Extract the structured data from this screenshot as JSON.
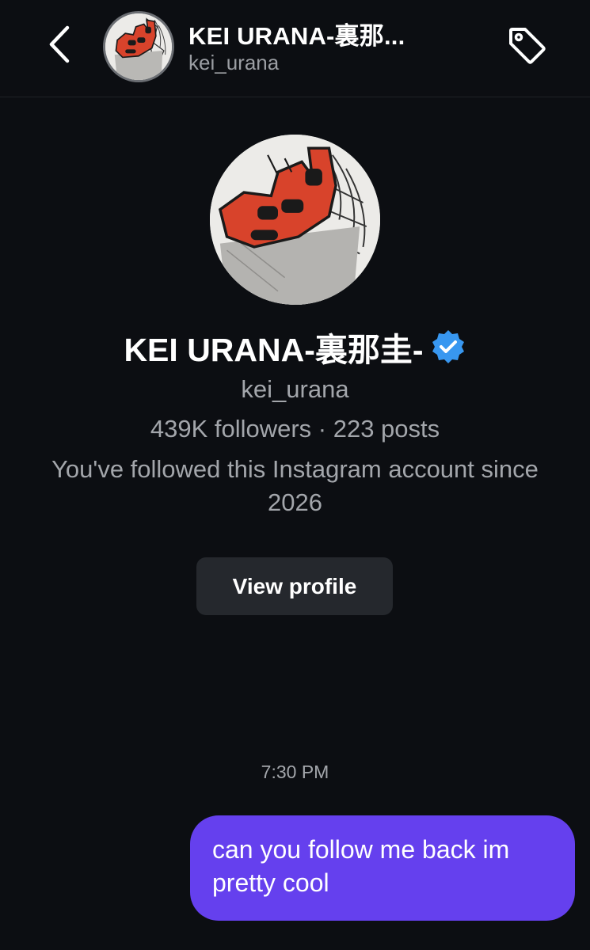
{
  "header": {
    "title": "KEI URANA-裏那...",
    "subtitle": "kei_urana"
  },
  "profile": {
    "name": "KEI URANA-裏那圭-",
    "username": "kei_urana",
    "stats": "439K followers · 223 posts",
    "followed_note": "You've followed this Instagram account since 2026",
    "view_profile_label": "View profile"
  },
  "conversation": {
    "timestamp": "7:30 PM",
    "messages": [
      {
        "text": "can you follow me back im pretty cool",
        "sender": "me"
      }
    ]
  },
  "colors": {
    "background": "#0c0e12",
    "bubble": "#6540ee",
    "verified": "#3897f0",
    "avatar_accent": "#d8432b"
  },
  "icons": {
    "back": "chevron-left-icon",
    "tag": "tag-icon",
    "verified": "verified-badge-icon"
  }
}
